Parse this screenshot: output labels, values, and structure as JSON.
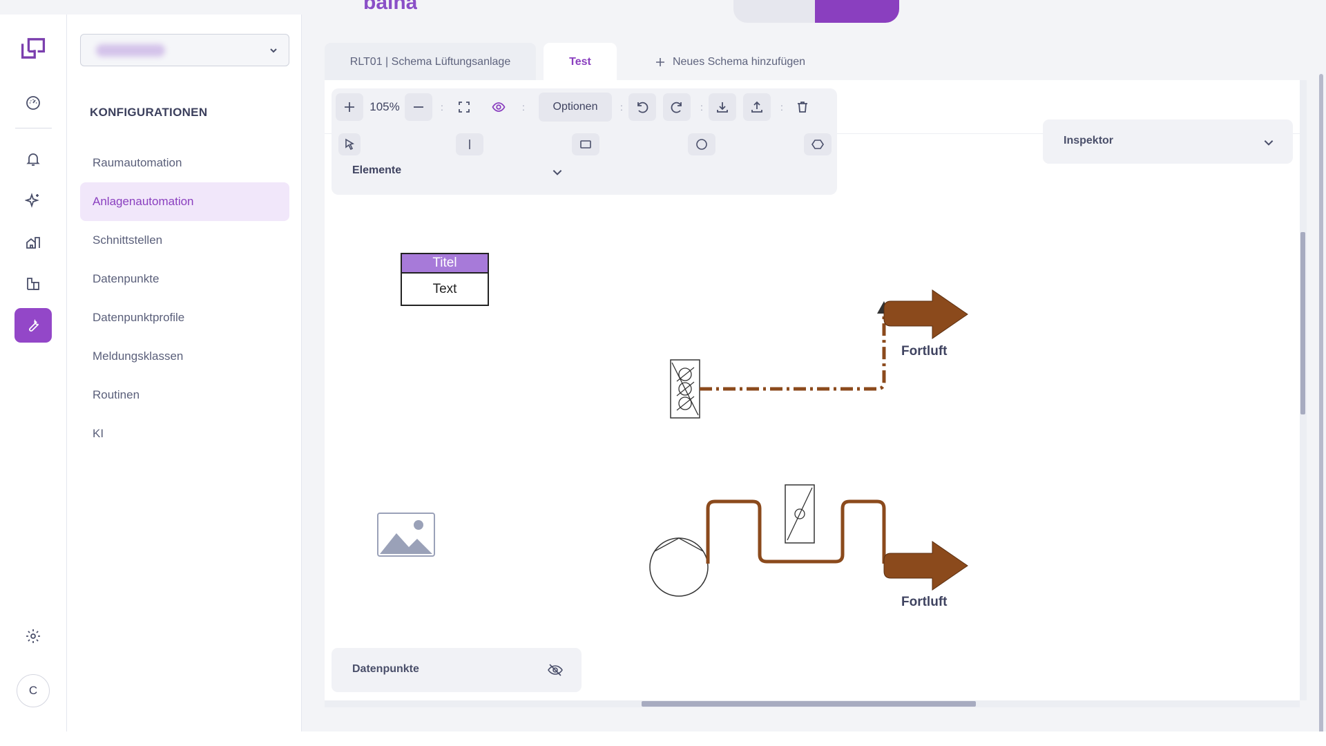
{
  "brand_fragment": "baina",
  "rail": {
    "items": [
      {
        "name": "dashboard-icon",
        "active": false
      },
      {
        "name": "bell-icon",
        "active": false
      },
      {
        "name": "sparkle-icon",
        "active": false
      },
      {
        "name": "building-icon",
        "active": false
      },
      {
        "name": "floorplan-icon",
        "active": false
      },
      {
        "name": "wrench-icon",
        "active": true
      },
      {
        "name": "gear-icon",
        "active": false
      }
    ],
    "avatar_initial": "C"
  },
  "sidebar": {
    "section_title": "KONFIGURATIONEN",
    "items": [
      {
        "label": "Raumautomation",
        "active": false
      },
      {
        "label": "Anlagenautomation",
        "active": true
      },
      {
        "label": "Schnittstellen",
        "active": false
      },
      {
        "label": "Datenpunkte",
        "active": false
      },
      {
        "label": "Datenpunktprofile",
        "active": false
      },
      {
        "label": "Meldungsklassen",
        "active": false
      },
      {
        "label": "Routinen",
        "active": false
      },
      {
        "label": "KI",
        "active": false
      }
    ]
  },
  "tabs": [
    {
      "label": "RLT01 | Schema Lüftungsanlage",
      "active": false
    },
    {
      "label": "Test",
      "active": true
    }
  ],
  "add_tab_label": "Neues Schema hinzufügen",
  "toolbar": {
    "zoom": "105%",
    "options_label": "Optionen",
    "elements_label": "Elemente"
  },
  "inspector_label": "Inspektor",
  "datapoints_label": "Datenpunkte",
  "diagram": {
    "title_box": {
      "title": "Titel",
      "text": "Text"
    },
    "labels": [
      "Fortluft",
      "Fortluft"
    ]
  },
  "colors": {
    "accent": "#8a3fbf",
    "active_bg": "#f1e7fa",
    "pipe": "#8b4a1c"
  }
}
